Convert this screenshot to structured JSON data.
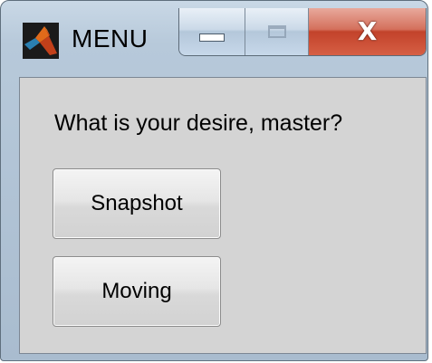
{
  "window": {
    "title": "MENU",
    "icon": "matlab-logo-icon",
    "controls": {
      "minimize_icon": "minimize-icon",
      "maximize_icon": "maximize-icon",
      "close_label": "X"
    }
  },
  "content": {
    "prompt": "What is your desire, master?",
    "buttons": [
      {
        "label": "Snapshot"
      },
      {
        "label": "Moving"
      }
    ]
  },
  "colors": {
    "close_button": "#c2422a",
    "panel_background": "#d4d4d4"
  }
}
